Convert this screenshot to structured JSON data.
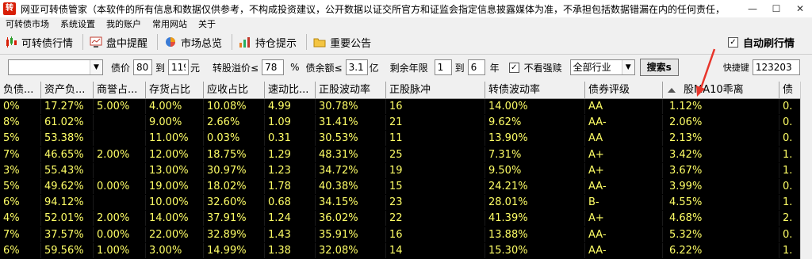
{
  "window": {
    "title": "网亚可转债管家（本软件的所有信息和数据仅供参考，不构成投资建议，公开数据以证交所官方和证监会指定信息披露媒体为准，不承担包括数据错漏在内的任何责任，据此买卖盈亏自负）",
    "minimize": "—",
    "maximize": "☐",
    "close": "✕"
  },
  "menu": [
    "可转债市场",
    "系统设置",
    "我的账户",
    "常用网站",
    "关于"
  ],
  "toolbar": {
    "items": [
      {
        "label": "可转债行情",
        "icon": "candlestick-chart-icon"
      },
      {
        "label": "盘中提醒",
        "icon": "monitor-alert-icon"
      },
      {
        "label": "市场总览",
        "icon": "pie-chart-icon"
      },
      {
        "label": "持仓提示",
        "icon": "bar-chart-icon"
      },
      {
        "label": "重要公告",
        "icon": "folder-icon"
      }
    ],
    "auto_refresh_label": "自动刷行情",
    "auto_refresh_checked": "✓"
  },
  "filters": {
    "bond_price_label": "债价",
    "price_from": "80",
    "to_label": "到",
    "price_to": "119",
    "price_unit": "元",
    "premium_label": "转股溢价≤",
    "premium": "78",
    "premium_unit": "%",
    "balance_label": "债余额≤",
    "balance": "3.1",
    "balance_unit": "亿",
    "years_label": "剩余年限",
    "years_from": "1",
    "years_to_label": "到",
    "years_to": "6",
    "years_unit": "年",
    "no_forced_label": "不看强赎",
    "no_forced_checked": "✓",
    "industry": "全部行业",
    "search_button": "搜索s",
    "hotkey_label": "快捷键",
    "hotkey_value": "123203"
  },
  "table": {
    "headers": [
      "负债...",
      "资产负...",
      "商誉占...",
      "存货占比",
      "应收占比",
      "速动比...",
      "正股波动率",
      "正股脉冲",
      "转债波动率",
      "债券评级",
      "股MA10乖离",
      "债"
    ],
    "rows": [
      [
        "0%",
        "17.27%",
        "5.00%",
        "4.00%",
        "10.08%",
        "4.99",
        "30.78%",
        "16",
        "14.00%",
        "AA",
        "1.12%",
        "0."
      ],
      [
        "8%",
        "61.02%",
        "",
        "9.00%",
        "2.66%",
        "1.09",
        "31.41%",
        "21",
        "9.62%",
        "AA-",
        "2.06%",
        "0."
      ],
      [
        "5%",
        "53.38%",
        "",
        "11.00%",
        "0.03%",
        "0.31",
        "30.53%",
        "11",
        "13.90%",
        "AA",
        "2.13%",
        "0."
      ],
      [
        "7%",
        "46.65%",
        "2.00%",
        "12.00%",
        "18.75%",
        "1.29",
        "48.31%",
        "25",
        "7.31%",
        "A+",
        "3.42%",
        "1."
      ],
      [
        "3%",
        "55.43%",
        "",
        "13.00%",
        "30.97%",
        "1.23",
        "34.72%",
        "19",
        "9.50%",
        "A+",
        "3.67%",
        "1."
      ],
      [
        "5%",
        "49.62%",
        "0.00%",
        "19.00%",
        "18.02%",
        "1.78",
        "40.38%",
        "15",
        "24.21%",
        "AA-",
        "3.99%",
        "0."
      ],
      [
        "6%",
        "94.12%",
        "",
        "10.00%",
        "32.60%",
        "0.68",
        "34.15%",
        "23",
        "28.01%",
        "B-",
        "4.55%",
        "1."
      ],
      [
        "4%",
        "52.01%",
        "2.00%",
        "14.00%",
        "37.91%",
        "1.24",
        "36.02%",
        "22",
        "41.39%",
        "A+",
        "4.68%",
        "2."
      ],
      [
        "7%",
        "37.57%",
        "0.00%",
        "22.00%",
        "32.89%",
        "1.43",
        "35.91%",
        "16",
        "13.88%",
        "AA-",
        "5.32%",
        "0."
      ],
      [
        "6%",
        "59.56%",
        "1.00%",
        "3.00%",
        "14.99%",
        "1.38",
        "32.08%",
        "14",
        "15.30%",
        "AA-",
        "6.22%",
        "1."
      ]
    ]
  },
  "colors": {
    "grid_bg": "#000000",
    "cell_text": "#ffff66",
    "annotation_arrow": "#e8352b"
  }
}
